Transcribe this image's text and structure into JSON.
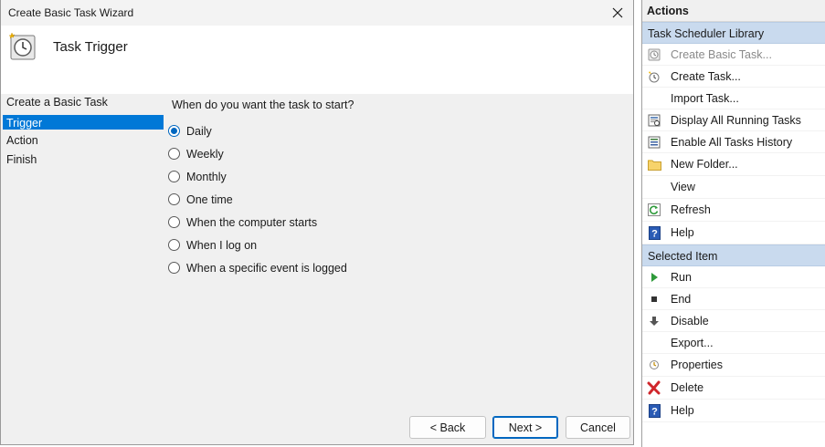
{
  "dialog": {
    "title": "Create Basic Task Wizard",
    "header_title": "Task Trigger",
    "steps": [
      "Create a Basic Task",
      "Trigger",
      "Action",
      "Finish"
    ],
    "active_step": "Trigger",
    "question": "When do you want the task to start?",
    "options": [
      "Daily",
      "Weekly",
      "Monthly",
      "One time",
      "When the computer starts",
      "When I log on",
      "When a specific event is logged"
    ],
    "selected_option": "Daily",
    "buttons": {
      "back": "< Back",
      "next": "Next >",
      "cancel": "Cancel"
    },
    "accent_color": "#0078d7"
  },
  "actions_pane": {
    "title": "Actions",
    "sections": [
      {
        "label": "Task Scheduler Library",
        "items": [
          {
            "label": "Create Basic Task...",
            "icon": "create-basic-task-icon",
            "disabled": true
          },
          {
            "label": "Create Task...",
            "icon": "create-task-icon"
          },
          {
            "label": "Import Task...",
            "icon": ""
          },
          {
            "label": "Display All Running Tasks",
            "icon": "running-tasks-icon"
          },
          {
            "label": "Enable All Tasks History",
            "icon": "tasks-history-icon"
          },
          {
            "label": "New Folder...",
            "icon": "folder-icon"
          },
          {
            "label": "View",
            "icon": ""
          },
          {
            "label": "Refresh",
            "icon": "refresh-icon"
          },
          {
            "label": "Help",
            "icon": "help-icon"
          }
        ]
      },
      {
        "label": "Selected Item",
        "items": [
          {
            "label": "Run",
            "icon": "run-icon"
          },
          {
            "label": "End",
            "icon": "end-icon"
          },
          {
            "label": "Disable",
            "icon": "disable-icon"
          },
          {
            "label": "Export...",
            "icon": ""
          },
          {
            "label": "Properties",
            "icon": "properties-icon"
          },
          {
            "label": "Delete",
            "icon": "delete-icon"
          },
          {
            "label": "Help",
            "icon": "help-icon"
          }
        ]
      }
    ]
  }
}
